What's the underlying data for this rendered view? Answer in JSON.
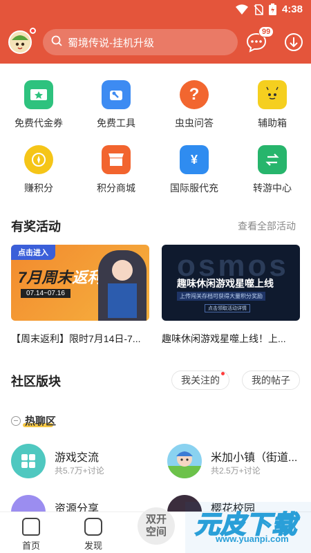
{
  "status": {
    "time": "4:38"
  },
  "header": {
    "search_placeholder": "蜀境传说-挂机升级",
    "message_badge": "99"
  },
  "grid": [
    {
      "label": "免费代金券",
      "icon": "coupon-icon",
      "color": "#2ec27e"
    },
    {
      "label": "免费工具",
      "icon": "tool-icon",
      "color": "#3d8bf2"
    },
    {
      "label": "虫虫问答",
      "icon": "question-icon",
      "color": "#f2662f"
    },
    {
      "label": "辅助箱",
      "icon": "robot-icon",
      "color": "#f5cf1f"
    },
    {
      "label": "赚积分",
      "icon": "coin-icon",
      "color": "#f5c518"
    },
    {
      "label": "积分商城",
      "icon": "shop-icon",
      "color": "#f2642e"
    },
    {
      "label": "国际服代充",
      "icon": "wallet-icon",
      "color": "#2f8cf0"
    },
    {
      "label": "转游中心",
      "icon": "transfer-icon",
      "color": "#27b56c"
    }
  ],
  "activities": {
    "title": "有奖活动",
    "more": "查看全部活动",
    "cards": [
      {
        "banner_tag": "点击进入",
        "banner_title_a": "7月周末",
        "banner_title_b": "返利",
        "banner_date": "07.14~07.16",
        "caption": "【周末返利】限时7月14日-7..."
      },
      {
        "banner_title": "趣味休闲游戏星噬上线",
        "banner_line": "上传闯关存档可获得大量积分奖励",
        "banner_small": "点击领取活动详情",
        "banner_bg_text": "osmos",
        "caption": "趣味休闲游戏星噬上线！上..."
      }
    ]
  },
  "community": {
    "title": "社区版块",
    "pill_following": "我关注的",
    "pill_posts": "我的帖子",
    "hot_label": "热聊区",
    "boards": [
      {
        "name": "游戏交流",
        "sub": "共5.7万+讨论"
      },
      {
        "name": "米加小镇（街道...",
        "sub": "共2.5万+讨论"
      },
      {
        "name": "资源分享",
        "sub": ""
      },
      {
        "name": "樱花校园",
        "sub": ""
      }
    ]
  },
  "nav": {
    "home": "首页",
    "discover": "发现",
    "double": "双开\n空间"
  },
  "watermark": {
    "big": "元皮下载",
    "small": "www.yuanpi.com"
  }
}
